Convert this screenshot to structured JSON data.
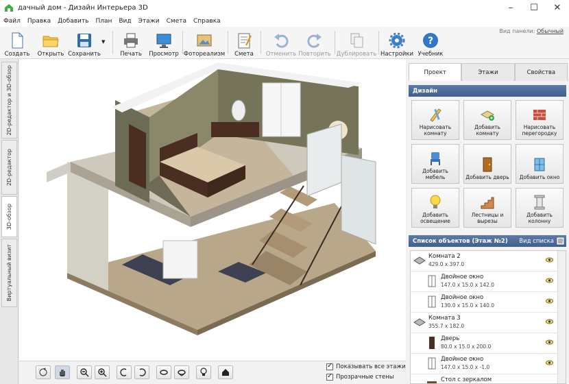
{
  "window": {
    "title": "дачный дом - Дизайн Интерьера 3D"
  },
  "menu": [
    "Файл",
    "Правка",
    "Добавить",
    "План",
    "Вид",
    "Этажи",
    "Смета",
    "Справка"
  ],
  "toolbar": {
    "create": "Создать",
    "open": "Открыть",
    "save": "Сохранить",
    "print": "Печать",
    "preview": "Просмотр",
    "photoreal": "Фотореализм",
    "estimate": "Смета",
    "undo": "Отменить",
    "redo": "Повторить",
    "duplicate": "Дублировать",
    "settings": "Настройки",
    "tutorial": "Учебник",
    "panel_view_label": "Вид панели:",
    "panel_view_value": "Обычный"
  },
  "vtabs": [
    "2D-редактор и 3D-обзор",
    "2D-редактор",
    "3D-обзор",
    "Виртуальный визит"
  ],
  "view_options": {
    "show_all_floors": "Показывать все этажи",
    "transparent_walls": "Прозрачные стены"
  },
  "right_panel": {
    "tabs": [
      "Проект",
      "Этажи",
      "Свойства"
    ],
    "design_header": "Дизайн",
    "design_buttons": [
      {
        "label": "Нарисовать комнату"
      },
      {
        "label": "Добавить комнату"
      },
      {
        "label": "Нарисовать перегородку"
      },
      {
        "label": "Добавить мебель"
      },
      {
        "label": "Добавить дверь"
      },
      {
        "label": "Добавить окно"
      },
      {
        "label": "Добавить освещение"
      },
      {
        "label": "Лестницы и вырезы"
      },
      {
        "label": "Добавить колонну"
      }
    ],
    "objects_header": "Список объектов (Этаж №2)",
    "objects_view": "Вид списка",
    "objects": [
      {
        "name": "Комната 2",
        "dims": "429.0 x 397.0",
        "kind": "room"
      },
      {
        "name": "Двойное окно",
        "dims": "147.0 x 15.0 x 142.0",
        "kind": "window"
      },
      {
        "name": "Двойное окно",
        "dims": "130.0 x 15.0 x 140.0",
        "kind": "window"
      },
      {
        "name": "Комната 3",
        "dims": "355.7 x 182.0",
        "kind": "room"
      },
      {
        "name": "Дверь",
        "dims": "80.0 x 15.0 x 200.0",
        "kind": "door"
      },
      {
        "name": "Двойное окно",
        "dims": "147.0 x 15.0 x -1.0",
        "kind": "window"
      },
      {
        "name": "Стол с зеркалом",
        "dims": "",
        "kind": "table"
      }
    ]
  }
}
